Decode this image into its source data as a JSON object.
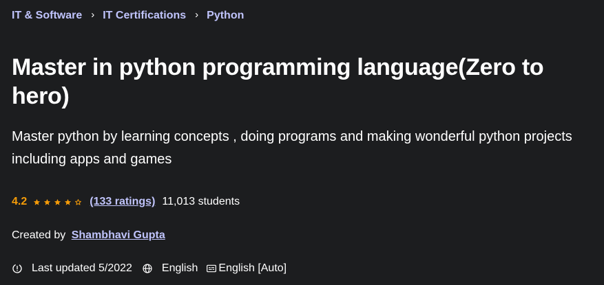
{
  "breadcrumb": {
    "items": [
      "IT & Software",
      "IT Certifications",
      "Python"
    ],
    "separator": "›"
  },
  "course": {
    "title": "Master in python programming language(Zero to hero)",
    "subtitle": "Master python by learning concepts , doing programs and making wonderful python projects including apps and games"
  },
  "rating": {
    "value": "4.2",
    "stars_filled_level": 4.2,
    "stars_total": 5,
    "count_label": "(133 ratings)",
    "students_label": "11,013 students"
  },
  "creator": {
    "prefix": "Created by",
    "name": "Shambhavi Gupta"
  },
  "meta": {
    "last_updated": "Last updated 5/2022",
    "language": "English",
    "captions": "English [Auto]"
  },
  "colors": {
    "background": "#1c1d1f",
    "link": "#c0c4fc",
    "rating": "#f69c08",
    "text": "#ffffff"
  }
}
